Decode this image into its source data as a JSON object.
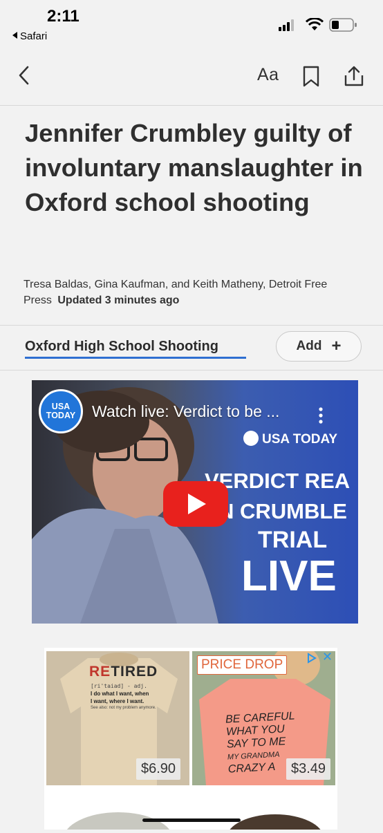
{
  "status_bar": {
    "time": "2:11",
    "back_app": "Safari"
  },
  "toolbar": {
    "text_size": "Aa"
  },
  "article": {
    "headline": "Jennifer Crumbley guilty of involuntary manslaughter in Oxford school shooting",
    "byline": "Tresa Baldas, Gina Kaufman, and Keith Matheny, Detroit Free Press",
    "updated": "Updated 3 minutes ago"
  },
  "topic": {
    "label": "Oxford High School Shooting",
    "add_label": "Add",
    "add_icon": "+"
  },
  "video": {
    "channel_logo": "USA TODAY",
    "title": "Watch live: Verdict to be ...",
    "brand": "USA TODAY",
    "overlay_line1": "VERDICT REA",
    "overlay_line2": "N CRUMBLE",
    "overlay_line3": "TRIAL",
    "overlay_line4": "LIVE"
  },
  "ads": {
    "item1": {
      "shirt_title": "RETIRED",
      "shirt_phonetic": "[ri'taiad] - adj.",
      "shirt_line1": "I do what I want, when",
      "shirt_line2": "I want, where I want.",
      "shirt_line3": "See also: not my problem anymore.",
      "price": "$6.90"
    },
    "item2": {
      "badge": "PRICE DROP",
      "shirt_line1": "BE CAREFUL",
      "shirt_line2": "WHAT YOU",
      "shirt_line3": "SAY TO ME",
      "shirt_line4": "MY GRANDMA",
      "shirt_line5": "CRAZY A",
      "price": "$3.49"
    },
    "close": "✕"
  },
  "colors": {
    "accent_underline": "#2f6fd1",
    "play_red": "#e8211d",
    "usa_blue": "#2175d9",
    "badge_orange": "#e0663b"
  }
}
